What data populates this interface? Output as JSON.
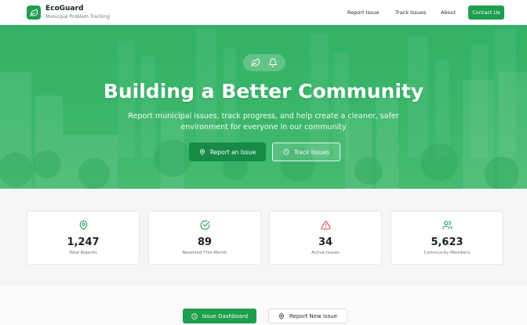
{
  "header": {
    "brand_name": "EcoGuard",
    "brand_sub": "Municipal Problem Tracking",
    "nav": [
      "Report Issue",
      "Track Issues",
      "About"
    ],
    "contact_label": "Contact Us"
  },
  "hero": {
    "icons": [
      "leaf-icon",
      "bell-icon"
    ],
    "title": "Building a Better Community",
    "description": "Report municipal issues, track progress, and help create a cleaner, safer environment for everyone in our community",
    "primary_button": "Report an Issue",
    "secondary_button": "Track Issues"
  },
  "stats": [
    {
      "icon": "map-pin-icon",
      "value": "1,247",
      "label": "Total Reports"
    },
    {
      "icon": "check-circle-icon",
      "value": "89",
      "label": "Resolved This Month"
    },
    {
      "icon": "alert-triangle-icon",
      "value": "34",
      "label": "Active Issues"
    },
    {
      "icon": "users-icon",
      "value": "5,623",
      "label": "Community Members"
    }
  ],
  "actions": {
    "dashboard_label": "Issue Dashboard",
    "report_label": "Report New Issue"
  },
  "colors": {
    "brand_green": "#1e9e4f",
    "hero_green": "#36b468",
    "alert_red": "#e04545"
  }
}
